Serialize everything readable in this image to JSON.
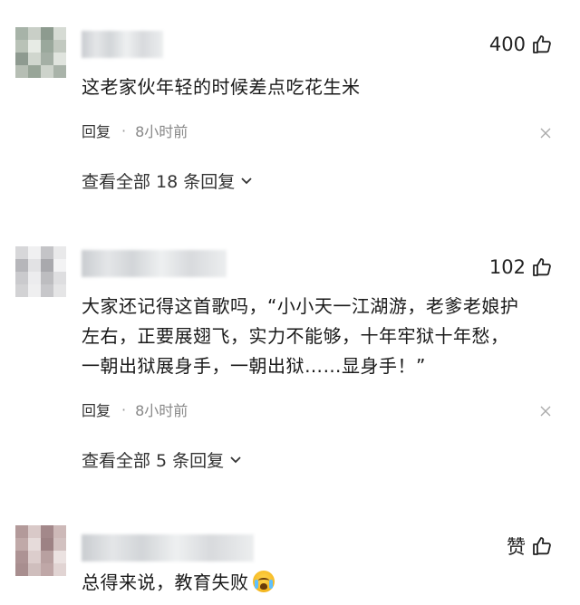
{
  "comments": [
    {
      "likes": "400",
      "text": "这老家伙年轻的时候差点吃花生米",
      "reply_label": "回复",
      "time": "8小时前",
      "view_replies": "查看全部 18 条回复",
      "avatar_colors": [
        "#a7b3a8",
        "#c9cfc7",
        "#8d9b8f",
        "#d6dbd4",
        "#b9c2b7",
        "#e7ebe5",
        "#9aa89c",
        "#c2c9c0",
        "#8e9a90",
        "#d0d6ce",
        "#a4afa5",
        "#e0e4de",
        "#b6beb4",
        "#98a598",
        "#cdd3cb",
        "#a9b3a9"
      ]
    },
    {
      "likes": "102",
      "text_lines": [
        "大家还记得这首歌吗，“小小天一江湖游，老爹老娘护",
        "左右，正要展翅飞，实力不能够，十年牢狱十年愁，",
        "一朝出狱展身手，一朝出狱……显身手！”"
      ],
      "reply_label": "回复",
      "time": "8小时前",
      "view_replies": "查看全部 5 条回复",
      "avatar_colors": [
        "#d7d7d9",
        "#f0f0f1",
        "#c4c4c7",
        "#e9e9ea",
        "#b6b6ba",
        "#e2e2e4",
        "#a9a9ad",
        "#f3f3f4",
        "#cacacd",
        "#ececee",
        "#bdbdc0",
        "#dedee0",
        "#d2d2d4",
        "#efeff0",
        "#c7c7ca",
        "#e5e5e6"
      ]
    },
    {
      "likes": "赞",
      "text": "总得来说，教育失败",
      "emoji": "crying-face-emoji",
      "avatar_colors": [
        "#b39a9a",
        "#d9c9c8",
        "#a3888a",
        "#cdb9b8",
        "#c0a9a8",
        "#e6dbda",
        "#9d8284",
        "#d2c1c0",
        "#ad9394",
        "#dccdcc",
        "#b8a0a0",
        "#ebe2e1",
        "#a88e8f",
        "#cfbebd",
        "#bfa7a7",
        "#e1d4d3"
      ]
    }
  ]
}
